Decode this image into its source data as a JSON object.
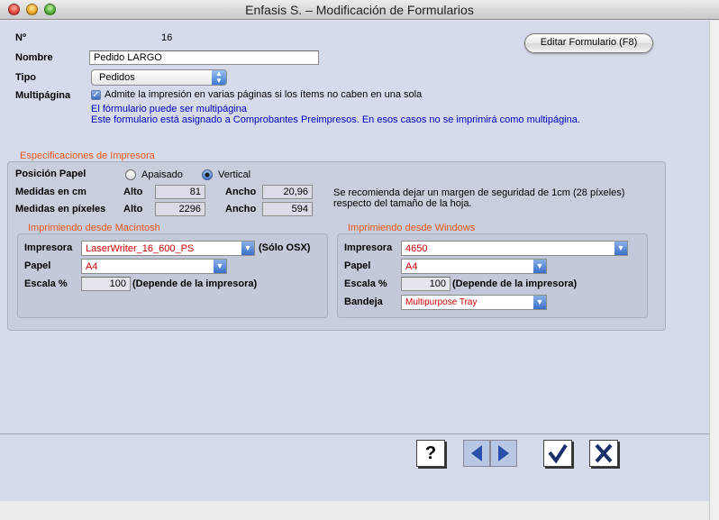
{
  "window": {
    "title": "Enfasis S. – Modificación de Formularios"
  },
  "form": {
    "numero_label": "Nº",
    "numero_value": "16",
    "nombre_label": "Nombre",
    "nombre_value": "Pedido LARGO",
    "tipo_label": "Tipo",
    "tipo_value": "Pedidos",
    "multipagina_label": "Multipágina",
    "multipagina_checkbox_label": "Admite la impresión en varias páginas si los ítems no caben en una sola",
    "multipagina_checked": true,
    "info_line1": "El fórmulario puede ser multipágina",
    "info_line2": "Este formulario está asignado a Comprobantes Preimpresos. En esos casos no se imprimirá como multipágina.",
    "editar_button": "Editar Formulario (F8)"
  },
  "impresora": {
    "section_title": "Especificaciones de Impresora",
    "posicion_label": "Posición Papel",
    "apaisado_label": "Apaisado",
    "vertical_label": "Vertical",
    "selected_orientation": "Vertical",
    "medidas_cm_label": "Medidas en cm",
    "medidas_px_label": "Medidas en píxeles",
    "alto_label": "Alto",
    "ancho_label": "Ancho",
    "alto_cm": "81",
    "ancho_cm": "20,96",
    "alto_px": "2296",
    "ancho_px": "594",
    "note_line1": "Se recomienda dejar un margen de seguridad de 1cm (28 píxeles)",
    "note_line2": "respecto del tamaño de la hoja."
  },
  "mac": {
    "title": "Imprimiendo desde Macintosh",
    "impresora_label": "Impresora",
    "impresora_value": "LaserWriter_16_600_PS",
    "osx_note": "(Sólo OSX)",
    "papel_label": "Papel",
    "papel_value": "A4",
    "escala_label": "Escala %",
    "escala_value": "100",
    "escala_note": "(Depende de la impresora)"
  },
  "windows": {
    "title": "Imprimiendo desde Windows",
    "impresora_label": "Impresora",
    "impresora_value": "4650",
    "papel_label": "Papel",
    "papel_value": "A4",
    "escala_label": "Escala %",
    "escala_value": "100",
    "escala_note": "(Depende de la impresora)",
    "bandeja_label": "Bandeja",
    "bandeja_value": "Multipurpose Tray"
  },
  "toolbar": {
    "help_icon": "question-mark-icon",
    "prev_icon": "left-arrow-icon",
    "next_icon": "right-arrow-icon",
    "accept_icon": "check-icon",
    "cancel_icon": "x-icon"
  },
  "colors": {
    "section_title": "#e8561a",
    "info_text": "#0000c0",
    "popup_value": "#d00000"
  }
}
